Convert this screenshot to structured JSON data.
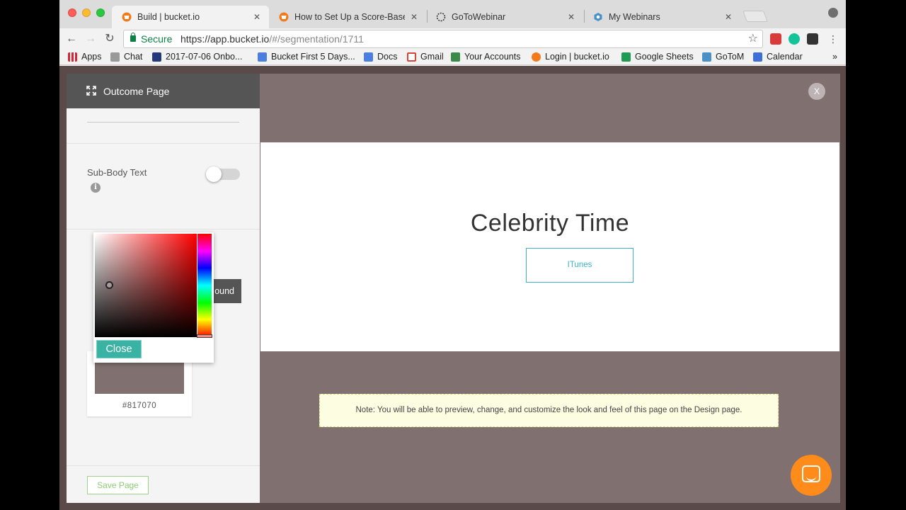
{
  "browser": {
    "tabs": [
      {
        "title": "Build | bucket.io"
      },
      {
        "title": "How to Set Up a Score-Based"
      },
      {
        "title": "GoToWebinar"
      },
      {
        "title": "My Webinars"
      }
    ],
    "address": {
      "secure_label": "Secure",
      "url_host": "https://app.bucket.io",
      "url_path": "/#/segmentation/1711"
    },
    "bookmarks": [
      {
        "label": "Apps"
      },
      {
        "label": "Chat"
      },
      {
        "label": "2017-07-06 Onbo..."
      },
      {
        "label": "Bucket First 5 Days..."
      },
      {
        "label": "Docs"
      },
      {
        "label": "Gmail"
      },
      {
        "label": "Your Accounts"
      },
      {
        "label": "Login | bucket.io"
      },
      {
        "label": "Google Sheets"
      },
      {
        "label": "GoToM"
      },
      {
        "label": "Calendar"
      },
      {
        "label": "»"
      }
    ]
  },
  "sidebar": {
    "title": "Outcome Page",
    "sub_body_label": "Sub-Body Text",
    "info_glyph": "i",
    "background_btn_label": "ound",
    "swatch": {
      "hex": "#817070",
      "color": "#817070"
    },
    "save_label": "Save Page"
  },
  "picker": {
    "close_label": "Close"
  },
  "preview": {
    "close_glyph": "X",
    "heading": "Celebrity Time",
    "button_label": "ITunes",
    "note": "Note: You will be able to preview, change, and customize the look and feel of this page on the Design page."
  },
  "colors": {
    "accent_teal": "#3ab3a4",
    "preview_bg": "#817070",
    "chat_orange": "#ff8c1a",
    "save_green": "#8ccc72"
  }
}
